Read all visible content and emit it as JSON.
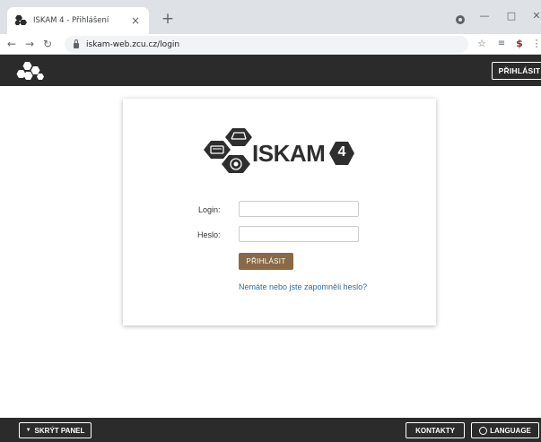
{
  "browser": {
    "tab_title": "ISKAM 4 - Přihlášení",
    "tab_close": "×",
    "new_tab": "+",
    "url": "iskam-web.zcu.cz/login",
    "back_icon": "arrow-left-icon",
    "forward_icon": "arrow-right-icon",
    "reload_icon": "reload-icon"
  },
  "header": {
    "login_button": "PŘIHLÁSIT"
  },
  "brand": {
    "name": "ISKAM",
    "version": "4"
  },
  "login_form": {
    "login_label": "Login:",
    "login_value": "",
    "password_label": "Heslo:",
    "password_value": "",
    "submit_label": "PŘIHLÁSIT",
    "forgot_password": "Nemáte nebo jste zapomněli heslo?"
  },
  "footer": {
    "hide_panel": "SKRÝT PANEL",
    "contacts": "KONTAKTY",
    "language": "LANGUAGE"
  },
  "colors": {
    "dark_bar": "#2b2b2b",
    "accent_brown": "#8a6947",
    "link_blue": "#2e6da4"
  }
}
